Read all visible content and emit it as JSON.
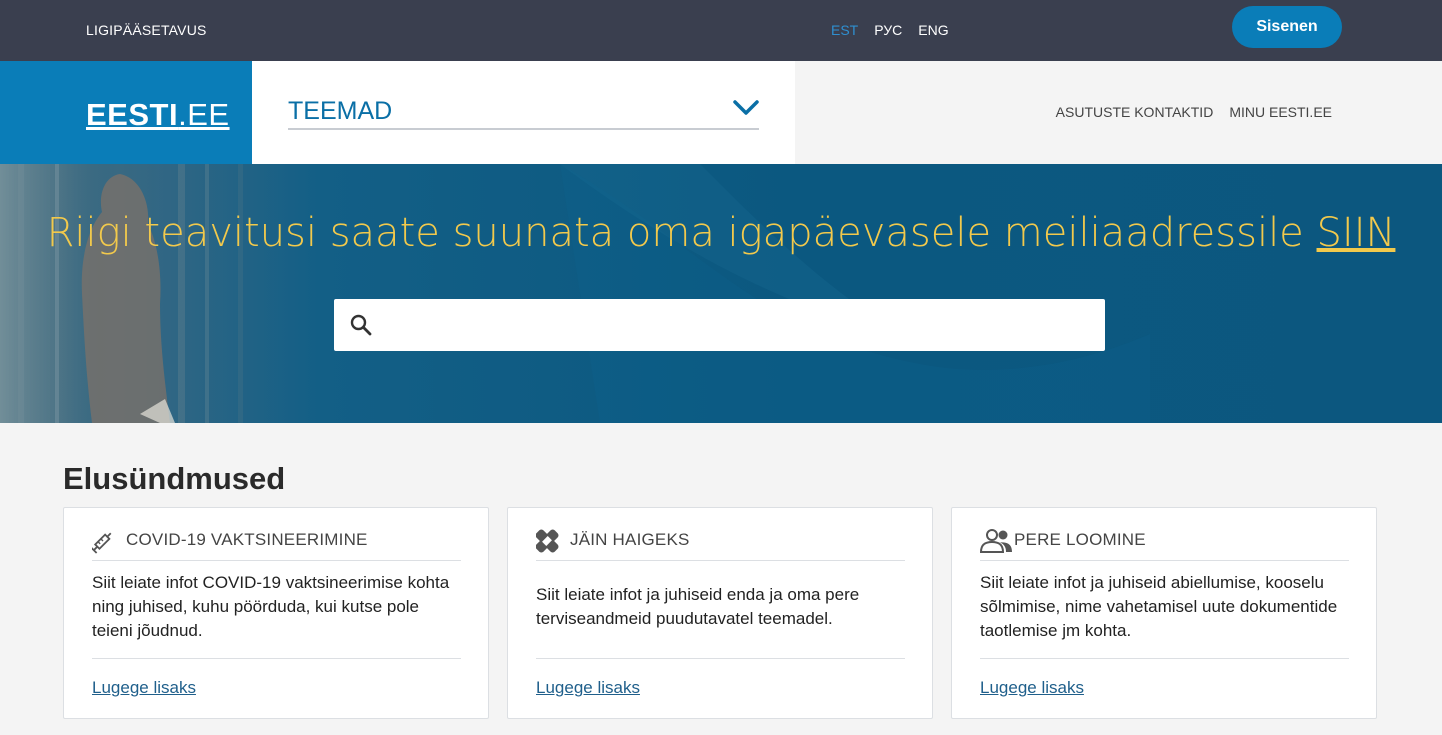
{
  "topbar": {
    "accessibility_label": "LIGIPÄÄSETAVUS",
    "languages": [
      {
        "label": "EST",
        "active": true
      },
      {
        "label": "РУС",
        "active": false
      },
      {
        "label": "ENG",
        "active": false
      }
    ],
    "login_label": "Sisenen"
  },
  "header": {
    "logo_bold": "EESTI",
    "logo_rest": ".EE",
    "topics_label": "TEEMAD",
    "links": [
      "ASUTUSTE KONTAKTID",
      "MINU EESTI.EE"
    ]
  },
  "hero": {
    "title_text": "Riigi teavitusi saate suunata oma igapäevasele meiliaadressile ",
    "title_link": "SIIN",
    "search_placeholder": ""
  },
  "life_events": {
    "title": "Elusündmused",
    "cards": [
      {
        "icon": "syringe-icon",
        "title": "COVID-19 VAKTSINEERIMINE",
        "text": "Siit leiate infot COVID-19 vaktsineerimise kohta ning juhised, kuhu pöörduda, kui kutse pole teieni jõudnud.",
        "link": "Lugege lisaks"
      },
      {
        "icon": "bandage-icon",
        "title": "JÄIN HAIGEKS",
        "text": "Siit leiate infot ja juhiseid enda ja oma pere terviseandmeid puudutavatel teemadel.",
        "link": "Lugege lisaks"
      },
      {
        "icon": "people-icon",
        "title": "PERE LOOMINE",
        "text": "Siit leiate infot ja juhiseid abiellumise, kooselu sõlmimise, nime vahetamisel uute dokumentide taotlemise jm kohta.",
        "link": "Lugege lisaks"
      }
    ]
  },
  "colors": {
    "topbar": "#3a3f4f",
    "brand_blue": "#0a7db8",
    "hero_title": "#f2c94c",
    "link": "#1f5f8b"
  }
}
